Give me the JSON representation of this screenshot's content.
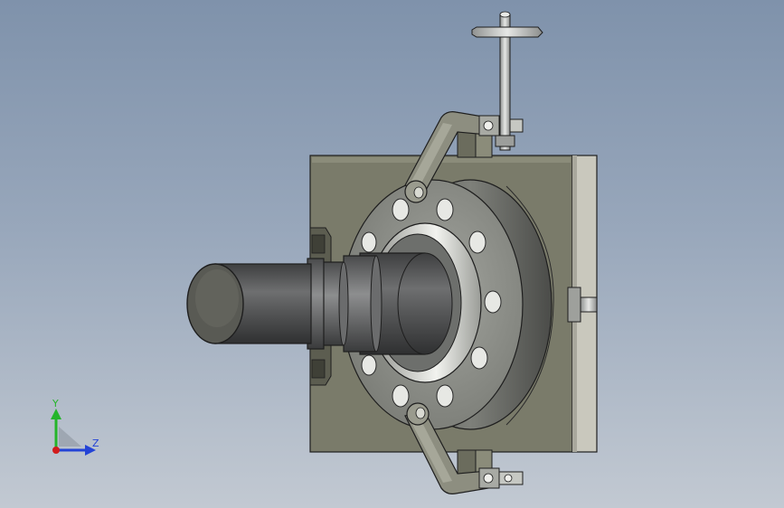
{
  "viewport": {
    "background_top": "#7f92ab",
    "background_bottom": "#c2c9d2"
  },
  "model": {
    "parts": [
      "base-plate",
      "side-plate",
      "flange",
      "bolt-holes",
      "shaft",
      "clamp-arm-top",
      "clamp-arm-bottom",
      "tee-handle",
      "side-pin"
    ],
    "colors": {
      "plate": "#7a7b6a",
      "plate_shadow": "#5c5d50",
      "side_plate": "#c9c8bd",
      "flange": "#8a8c86",
      "shaft": "#5b5c5c",
      "metal_light": "#d8dbd6",
      "edge": "#1e1e1e"
    }
  },
  "triad": {
    "y_label": "Y",
    "z_label": "Z",
    "x_color": "#d11c1c",
    "y_color": "#24b52a",
    "z_color": "#2343d6"
  }
}
